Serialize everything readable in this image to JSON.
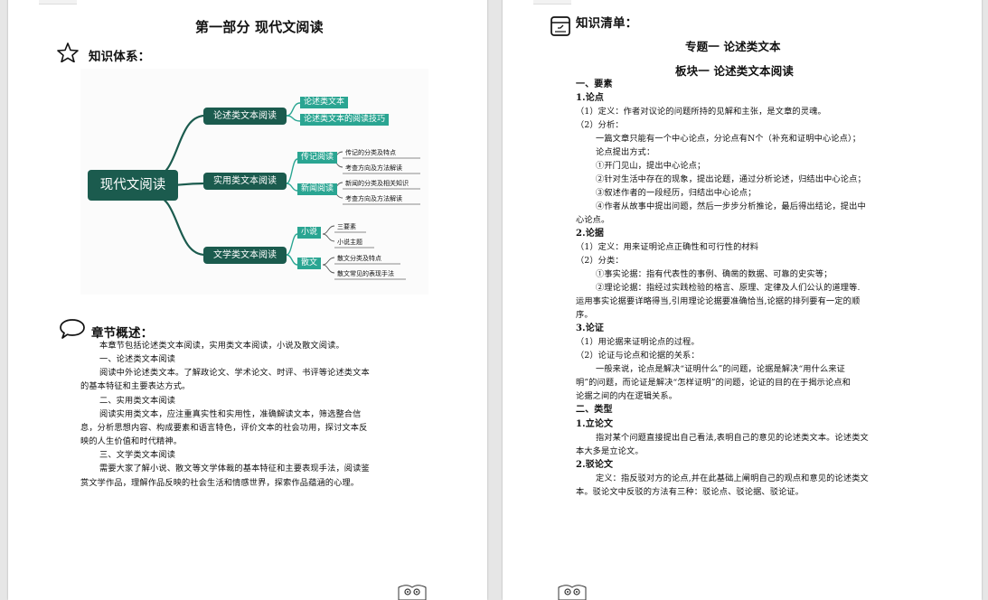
{
  "page1": {
    "part_title": "第一部分  现代文阅读",
    "knowledge_system_heading": "知识体系：",
    "mindmap": {
      "root": "现代文阅读",
      "branches": [
        {
          "label": "论述类文本阅读",
          "items": [
            "论述类文本",
            "论述类文本的阅读技巧"
          ]
        },
        {
          "label": "实用类文本阅读",
          "groups": [
            {
              "label": "传记阅读",
              "leaves": [
                "传记的分类及特点",
                "考查方向及方法解读"
              ]
            },
            {
              "label": "新闻阅读",
              "leaves": [
                "新闻的分类及相关知识",
                "考查方向及方法解读"
              ]
            }
          ]
        },
        {
          "label": "文学类文本阅读",
          "groups": [
            {
              "label": "小说",
              "leaves": [
                "三要素",
                "小说主题"
              ]
            },
            {
              "label": "散文",
              "leaves": [
                "散文分类及特点",
                "散文常见的表现手法"
              ]
            }
          ]
        }
      ]
    },
    "chapter_overview_heading": "章节概述：",
    "overview_lines": [
      "本章节包括论述类文本阅读，实用类文本阅读，小说及散文阅读。",
      "一、论述类文本阅读",
      "阅读中外论述类文本。了解政论文、学术论文、时评、书评等论述类文本",
      "的基本特征和主要表达方式。",
      "二、实用类文本阅读",
      "阅读实用类文本，应注重真实性和实用性，准确解读文本，筛选整合信",
      "息，分析思想内容、构成要素和语言特色，评价文本的社会功用，探讨文本反",
      "映的人生价值和时代精神。",
      "三、文学类文本阅读",
      "需要大家了解小说、散文等文学体裁的基本特征和主要表现手法，阅读鉴",
      "赏文学作品，理解作品反映的社会生活和情感世界，探索作品蕴涵的心理。"
    ]
  },
  "page2": {
    "checklist_heading": "知识清单：",
    "topic_title": "专题一   论述类文本",
    "block_title": "板块一   论述类文本阅读",
    "lines": [
      "一、要素",
      "1.论点",
      "（1）定义：作者对议论的问题所持的见解和主张，是文章的灵魂。",
      "（2）分析：",
      "一篇文章只能有一个中心论点，分论点有N个（补充和证明中心论点）；",
      "论点提出方式：",
      "①开门见山，提出中心论点；",
      "②针对生活中存在的现象，提出论题，通过分析论述，归结出中心论点；",
      "③叙述作者的一段经历，归结出中心论点；",
      "④作者从故事中提出问题，然后一步步分析推论，最后得出结论，提出中",
      "心论点。",
      "2.论据",
      "（1）定义：用来证明论点正确性和可行性的材料",
      "（2）分类：",
      "①事实论据：指有代表性的事例、确凿的数据、可靠的史实等；",
      "②理论论据：指经过实践检验的格言、原理、定律及人们公认的道理等.",
      "运用事实论据要详略得当,引用理论论据要准确恰当,论据的排列要有一定的顺",
      "序。",
      "3.论证",
      "（1）用论据来证明论点的过程。",
      "（2）论证与论点和论据的关系：",
      "一般来说，论点是解决“证明什么”的问题，论据是解决“用什么来证",
      "明”的问题，而论证是解决“怎样证明”的问题，论证的目的在于揭示论点和",
      "论据之间的内在逻辑关系。",
      "二、类型",
      "1.立论文",
      "指对某个问题直接提出自己看法,表明自己的意见的论述类文本。论述类文",
      "本大多是立论文。",
      "2.驳论文",
      "定义：指反驳对方的论点,并在此基础上阐明自己的观点和意见的论述类文",
      "本。驳论文中反驳的方法有三种：驳论点、驳论据、驳论证。"
    ]
  }
}
